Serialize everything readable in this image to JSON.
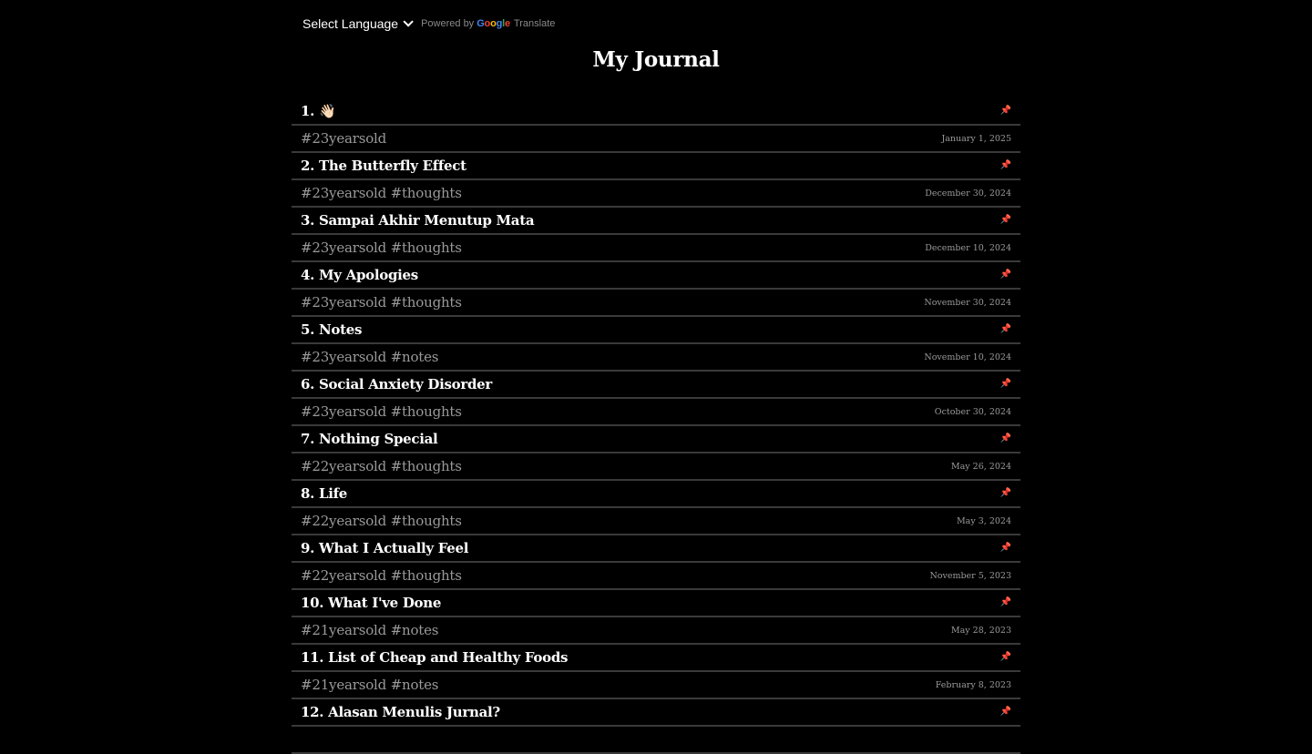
{
  "translate": {
    "select_label": "Select Language",
    "powered_by": "Powered by",
    "google_letters": [
      "G",
      "o",
      "o",
      "g",
      "l",
      "e"
    ],
    "translate_word": "Translate"
  },
  "page": {
    "title": "My Journal"
  },
  "entries": [
    {
      "title": "1. 👋🏻",
      "tags": "#23yearsold",
      "date": "January 1, 2025"
    },
    {
      "title": "2. The Butterfly Effect",
      "tags": "#23yearsold #thoughts",
      "date": "December 30, 2024"
    },
    {
      "title": "3. Sampai Akhir Menutup Mata",
      "tags": "#23yearsold #thoughts",
      "date": "December 10, 2024"
    },
    {
      "title": "4. My Apologies",
      "tags": "#23yearsold #thoughts",
      "date": "November 30, 2024"
    },
    {
      "title": "5. Notes",
      "tags": "#23yearsold #notes",
      "date": "November 10, 2024"
    },
    {
      "title": "6. Social Anxiety Disorder",
      "tags": "#23yearsold #thoughts",
      "date": "October 30, 2024"
    },
    {
      "title": "7. Nothing Special",
      "tags": "#22yearsold #thoughts",
      "date": "May 26, 2024"
    },
    {
      "title": "8. Life",
      "tags": "#22yearsold #thoughts",
      "date": "May 3, 2024"
    },
    {
      "title": "9. What I Actually Feel",
      "tags": "#22yearsold #thoughts",
      "date": "November 5, 2023"
    },
    {
      "title": "10. What I've Done",
      "tags": "#21yearsold #notes",
      "date": "May 28, 2023"
    },
    {
      "title": "11. List of Cheap and Healthy Foods",
      "tags": "#21yearsold #notes",
      "date": "February 8, 2023"
    },
    {
      "title": "12. Alasan Menulis Jurnal?",
      "tags": "",
      "date": ""
    }
  ],
  "icons": {
    "pin": "📌",
    "pin_color": "#e0414a"
  }
}
